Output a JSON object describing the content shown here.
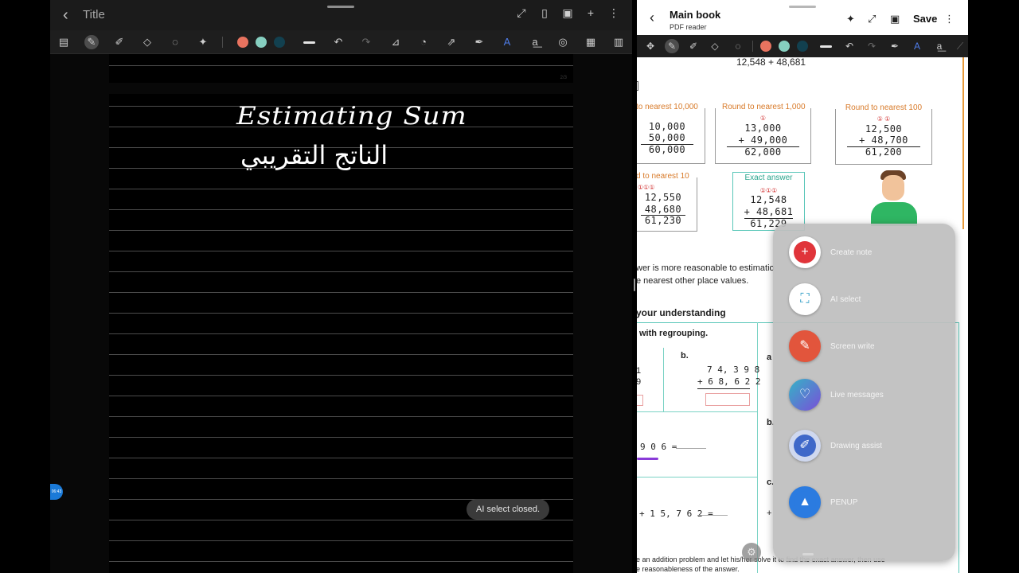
{
  "left_app": {
    "title": "Title",
    "page_indicator": "2/3",
    "handwriting_english": "Estimating Sum",
    "handwriting_arabic": "الناتج التقريبي",
    "side_badge": "06:43",
    "toast": "AI select closed.",
    "pen_colors": [
      "#e8735f",
      "#86cfc0",
      "#12404f"
    ]
  },
  "right_app": {
    "title": "Main book",
    "subtitle": "PDF reader",
    "save_label": "Save",
    "pen_colors": [
      "#e8735f",
      "#86cfc0",
      "#12404f"
    ],
    "pdf": {
      "top_problem": "12,548 + 48,681",
      "box_nearest_10000": {
        "title": "to nearest 10,000",
        "rows": [
          "10,000",
          "50,000",
          "60,000"
        ]
      },
      "box_nearest_1000": {
        "title": "Round to nearest 1,000",
        "carry": "①",
        "rows": [
          "13,000",
          "+ 49,000",
          "62,000"
        ]
      },
      "box_nearest_100": {
        "title": "Round to nearest 100",
        "carry": "① ①",
        "rows": [
          "12,500",
          "+ 48,700",
          "61,200"
        ]
      },
      "box_nearest_10": {
        "title": "d to nearest 10",
        "carry": "①①①",
        "rows": [
          "12,550",
          "48,680",
          "61,230"
        ]
      },
      "box_exact": {
        "title": "Exact answer",
        "carry": "①①①",
        "rows": [
          "12,548",
          "+ 48,681",
          "61,229"
        ]
      },
      "text_reasonable": "wer is more reasonable to estimatio",
      "text_nearest_other": "e nearest other place values.",
      "heading_understanding": "your understanding",
      "heading_regrouping": "with regrouping.",
      "label_b": "b.",
      "label_a_right": "a",
      "label_b_right": "b.",
      "label_c_right": "c.",
      "partial_1": "1",
      "partial_9": "9",
      "problem_b_top": "7 4, 3 9 8",
      "problem_b_bottom": "+ 6 8, 6 2 2",
      "expr_906": "9 0 6 =",
      "expr_15762": "+ 1 5, 7 6 2 =",
      "expr_plus_right": "+",
      "bottom_text_1": "e an addition problem and let his/her solve it to find the exact answer, then use",
      "bottom_text_2": "e reasonableness of the answer."
    }
  },
  "float_menu": {
    "items": [
      {
        "label": "Create note",
        "icon": "create-note-icon",
        "color": "#e0343a",
        "glyph": "+"
      },
      {
        "label": "AI select",
        "icon": "ai-select-icon",
        "color": "#3aa2c9",
        "glyph": "⛶"
      },
      {
        "label": "Screen write",
        "icon": "screen-write-icon",
        "color": "#e2553c",
        "glyph": "✎"
      },
      {
        "label": "Live messages",
        "icon": "live-messages-icon",
        "color": "#5b6fd6",
        "glyph": "♡"
      },
      {
        "label": "Drawing assist",
        "icon": "drawing-assist-icon",
        "color": "#3f68c9",
        "glyph": "✐"
      },
      {
        "label": "PENUP",
        "icon": "penup-icon",
        "color": "#2b7be0",
        "glyph": "▲"
      }
    ]
  }
}
